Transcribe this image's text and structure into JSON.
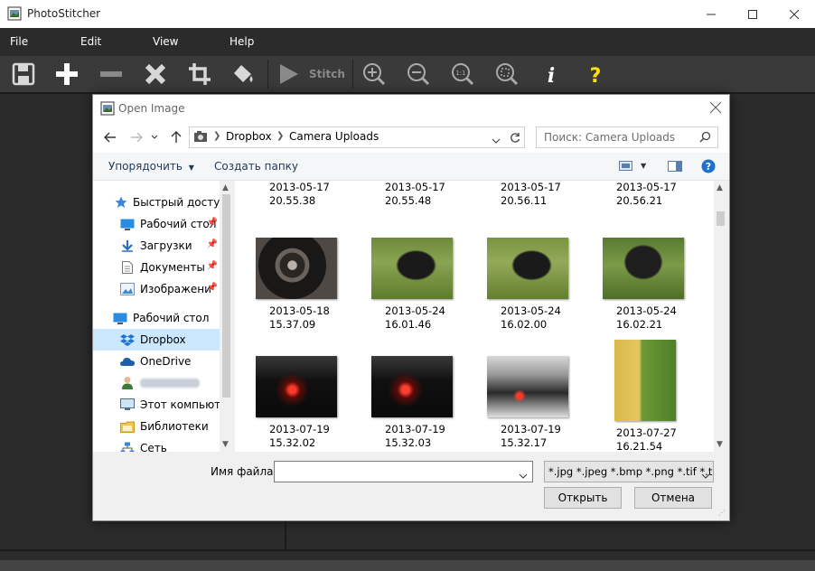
{
  "app": {
    "title": "PhotoStitcher"
  },
  "menu": [
    "File",
    "Edit",
    "View",
    "Help"
  ],
  "toolbar": {
    "stitch_label": "Stitch"
  },
  "colors": {
    "toolbar_bg": "#3a3a3a",
    "help_icon": "#ffe000",
    "selection": "#cce8ff",
    "link": "#1e395b"
  },
  "dialog": {
    "title": "Open Image",
    "breadcrumb": [
      "Dropbox",
      "Camera Uploads"
    ],
    "search_placeholder": "Поиск: Camera Uploads",
    "organize_label": "Упорядочить",
    "new_folder_label": "Создать папку",
    "nav": [
      {
        "label": "Быстрый доступ",
        "icon": "star-icon"
      },
      {
        "label": "Рабочий стол",
        "icon": "desktop-icon",
        "pinned": true
      },
      {
        "label": "Загрузки",
        "icon": "download-icon",
        "pinned": true
      },
      {
        "label": "Документы",
        "icon": "document-icon",
        "pinned": true
      },
      {
        "label": "Изображени",
        "icon": "pictures-icon",
        "pinned": true
      },
      {
        "label": "Рабочий стол",
        "icon": "desktop-icon"
      },
      {
        "label": "Dropbox",
        "icon": "dropbox-icon",
        "selected": true
      },
      {
        "label": "OneDrive",
        "icon": "cloud-icon"
      },
      {
        "label": "",
        "icon": "user-icon"
      },
      {
        "label": "Этот компьютер",
        "icon": "computer-icon"
      },
      {
        "label": "Библиотеки",
        "icon": "library-icon"
      },
      {
        "label": "Сеть",
        "icon": "network-icon"
      }
    ],
    "files_top": [
      {
        "date": "2013-05-17",
        "time": "20.55.38"
      },
      {
        "date": "2013-05-17",
        "time": "20.55.48"
      },
      {
        "date": "2013-05-17",
        "time": "20.56.11"
      },
      {
        "date": "2013-05-17",
        "time": "20.56.21"
      }
    ],
    "files_mid": [
      {
        "date": "2013-05-18",
        "time": "15.37.09"
      },
      {
        "date": "2013-05-24",
        "time": "16.01.46"
      },
      {
        "date": "2013-05-24",
        "time": "16.02.00"
      },
      {
        "date": "2013-05-24",
        "time": "16.02.21"
      }
    ],
    "files_bot": [
      {
        "date": "2013-07-19",
        "time": "15.32.02"
      },
      {
        "date": "2013-07-19",
        "time": "15.32.03"
      },
      {
        "date": "2013-07-19",
        "time": "15.32.17"
      },
      {
        "date": "2013-07-27",
        "time": "16.21.54"
      }
    ],
    "filename_label": "Имя файла:",
    "filename_value": "",
    "filter_value": "*.jpg *.jpeg *.bmp *.png *.tif *.t",
    "open_label": "Открыть",
    "cancel_label": "Отмена"
  }
}
